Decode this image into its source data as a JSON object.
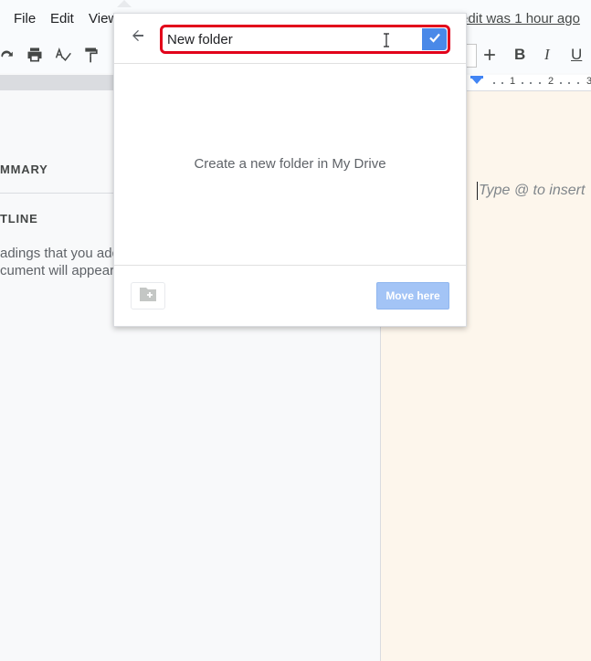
{
  "menubar": {
    "items": [
      "File",
      "Edit",
      "View"
    ],
    "last_edit": "edit was 1 hour ago"
  },
  "toolbar": {
    "icons": [
      "redo-icon",
      "print-icon",
      "spellcheck-icon",
      "paint-format-icon",
      "plus-icon"
    ],
    "bold": "B",
    "italic": "I",
    "underline": "U"
  },
  "ruler": {
    "numbers": [
      "1",
      "2",
      "3"
    ]
  },
  "outline": {
    "summary_heading": "MMARY",
    "outline_heading": "TLINE",
    "help_line1": "adings that you add",
    "help_line2": "cument will appear"
  },
  "document": {
    "placeholder": "Type @ to insert"
  },
  "dialog": {
    "input_value": "New folder",
    "empty_message": "Create a new folder in My Drive",
    "move_button": "Move here"
  },
  "colors": {
    "accent": "#4a89e8",
    "highlight": "#e2001a",
    "page": "#fdf6ec"
  }
}
